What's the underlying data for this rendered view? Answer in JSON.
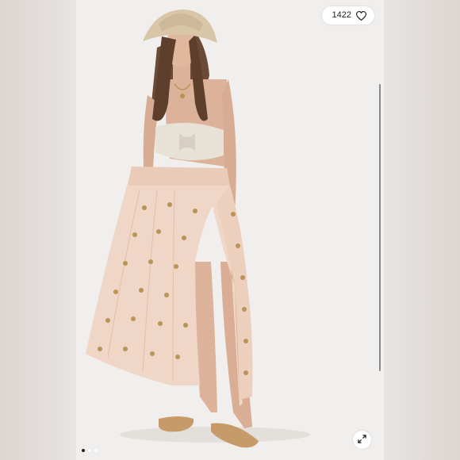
{
  "like_button": {
    "count": "1422",
    "icon": "heart-outline"
  },
  "carousel": {
    "total_images": 3,
    "active_index": 0
  },
  "expand_button": {
    "icon": "expand-arrows"
  },
  "colors": {
    "background": "#ebe8e6",
    "photo_background": "#f1efed",
    "skirt": "#f0d6c6",
    "embroidery": "#b89457",
    "hat": "#d9c6a8",
    "top": "#e8e2d6"
  }
}
